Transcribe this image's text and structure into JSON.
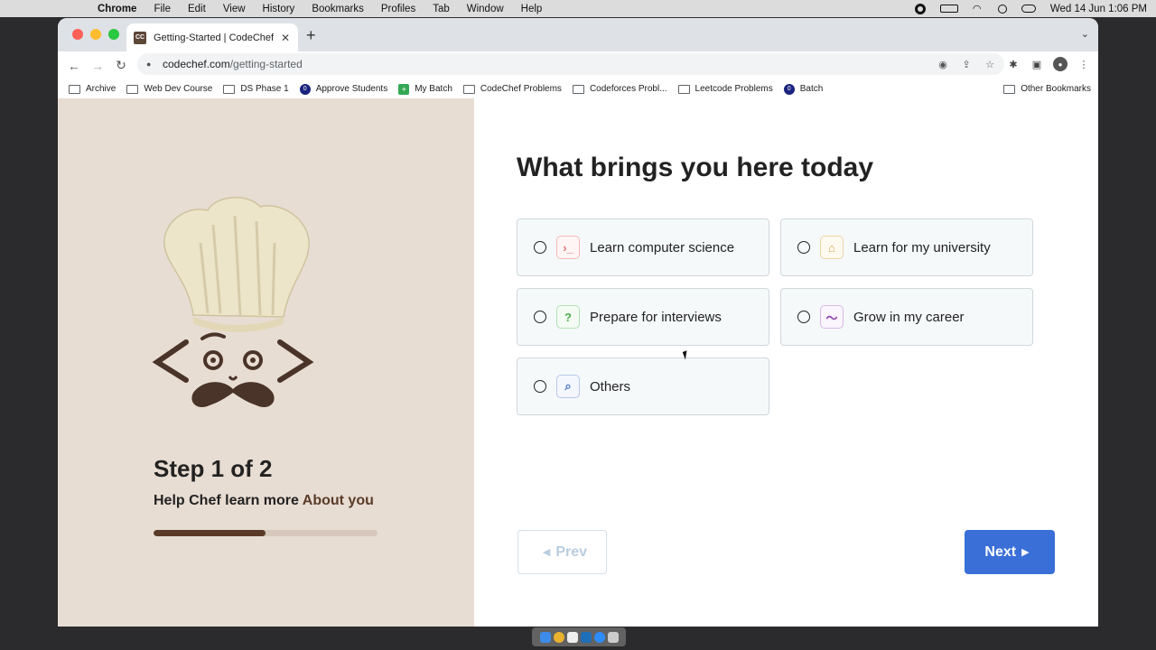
{
  "menubar": {
    "items": [
      "Chrome",
      "File",
      "Edit",
      "View",
      "History",
      "Bookmarks",
      "Profiles",
      "Tab",
      "Window",
      "Help"
    ],
    "clock": "Wed 14 Jun  1:06 PM"
  },
  "browser": {
    "tab_title": "Getting-Started | CodeChef",
    "favicon_text": "CC",
    "url_host": "codechef.com",
    "url_path": "/getting-started",
    "bookmarks": [
      {
        "label": "Archive",
        "kind": "folder"
      },
      {
        "label": "Web Dev Course",
        "kind": "folder"
      },
      {
        "label": "DS Phase 1",
        "kind": "folder"
      },
      {
        "label": "Approve Students",
        "kind": "site",
        "color": "#1a237e"
      },
      {
        "label": "My Batch",
        "kind": "sheet"
      },
      {
        "label": "CodeChef Problems",
        "kind": "folder"
      },
      {
        "label": "Codeforces Probl...",
        "kind": "folder"
      },
      {
        "label": "Leetcode Problems",
        "kind": "folder"
      },
      {
        "label": "Batch",
        "kind": "site",
        "color": "#1a237e"
      }
    ],
    "other_bookmarks": "Other Bookmarks"
  },
  "onboarding": {
    "step_title": "Step 1 of 2",
    "step_sub_prefix": "Help Chef learn more ",
    "step_sub_accent": "About you",
    "progress": 0.5,
    "question": "What brings you here today",
    "options": [
      {
        "label": "Learn computer science",
        "icon": "terminal-icon",
        "glyph": "›_",
        "color": "#e57373"
      },
      {
        "label": "Learn for my university",
        "icon": "university-icon",
        "glyph": "⌂",
        "color": "#d4a04a"
      },
      {
        "label": "Prepare for interviews",
        "icon": "question-icon",
        "glyph": "?",
        "color": "#4caf50"
      },
      {
        "label": "Grow in my career",
        "icon": "trend-icon",
        "glyph": "〜",
        "color": "#8e44ad"
      },
      {
        "label": "Others",
        "icon": "search-icon",
        "glyph": "⌕",
        "color": "#3f6fc9"
      }
    ],
    "prev_label": "Prev",
    "next_label": "Next"
  },
  "colors": {
    "accent": "#3a6fd8",
    "brand_brown": "#5a3b28",
    "panel_bg": "#e8ddd3"
  }
}
